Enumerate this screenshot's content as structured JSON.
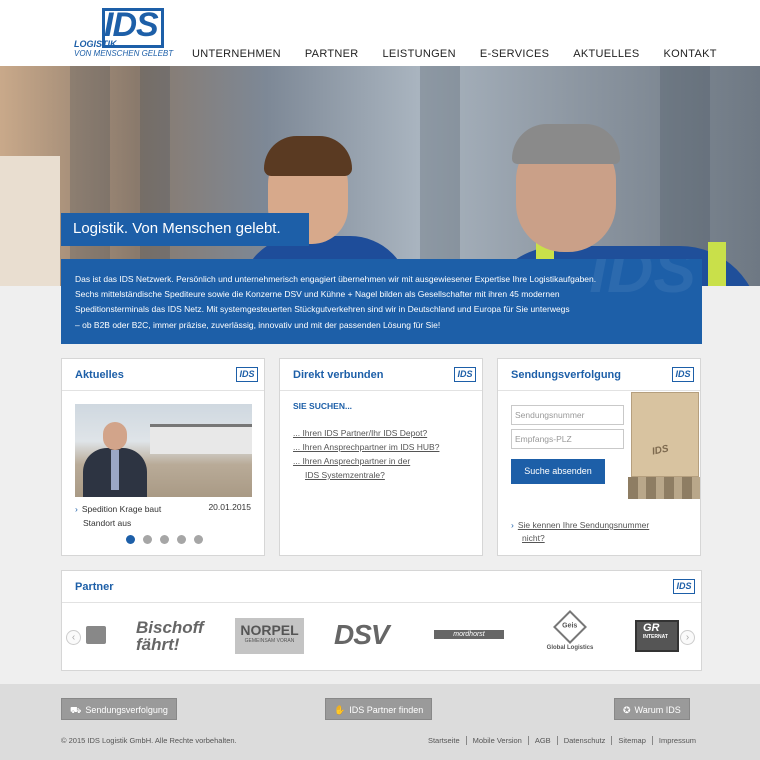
{
  "header": {
    "logo_text": "IDS",
    "logo_sub1": "LOGISTIK",
    "logo_sub2": "VON MENSCHEN GELEBT",
    "nav": [
      "UNTERNEHMEN",
      "PARTNER",
      "LEISTUNGEN",
      "E-SERVICES",
      "AKTUELLES",
      "KONTAKT"
    ]
  },
  "hero": {
    "title": "Logistik. Von Menschen gelebt.",
    "intro_lines": [
      "Das ist das IDS Netzwerk. Persönlich und unternehmerisch engagiert übernehmen wir mit ausgewiesener Expertise Ihre Logistikaufgaben.",
      "Sechs mittelständische Spediteure sowie die Konzerne DSV und Kühne + Nagel bilden als Gesellschafter mit ihren 45 modernen",
      "Speditionsterminals das IDS Netz. Mit systemgesteuerten Stückgutverkehren sind wir in Deutschland und Europa für Sie unterwegs",
      "– ob B2B oder B2C, immer präzise, zuverlässig, innovativ und mit der passenden Lösung für Sie!"
    ]
  },
  "aktuelles": {
    "title": "Aktuelles",
    "badge": "IDS",
    "news_line1": "Spedition Krage baut",
    "news_line2": "Standort aus",
    "date": "20.01.2015",
    "slides": 5,
    "active_slide": 1
  },
  "direkt": {
    "title": "Direkt verbunden",
    "badge": "IDS",
    "heading": "SIE SUCHEN...",
    "links": [
      "... Ihren IDS Partner/Ihr IDS Depot?",
      "... Ihren Ansprechpartner im IDS HUB?",
      "... Ihren Ansprechpartner in der",
      "IDS Systemzentrale?"
    ]
  },
  "sendung": {
    "title": "Sendungsverfolgung",
    "badge": "IDS",
    "placeholder_number": "Sendungsnummer",
    "placeholder_plz": "Empfangs-PLZ",
    "button": "Suche absenden",
    "box_stamp": "IDS",
    "link_line1": "Sie kennen Ihre Sendungsnummer",
    "link_line2": "nicht?"
  },
  "partner": {
    "title": "Partner",
    "badge": "IDS",
    "logos": [
      "Bischoff fährt!",
      "NORPEL",
      "GEMEINSAM VORAN",
      "DSV",
      "mordhorst",
      "Geis",
      "Global Logistics",
      "GR",
      "INTERNAT"
    ]
  },
  "footer": {
    "buttons": [
      "Sendungsverfolgung",
      "IDS Partner finden",
      "Warum IDS"
    ],
    "copyright": "© 2015 IDS Logistik GmbH. Alle Rechte vorbehalten.",
    "links": [
      "Startseite",
      "Mobile Version",
      "AGB",
      "Datenschutz",
      "Sitemap",
      "Impressum"
    ]
  },
  "colors": {
    "brand_blue": "#1d5fa8",
    "footer_bg": "#dcdcdc",
    "content_bg": "#efefef"
  }
}
